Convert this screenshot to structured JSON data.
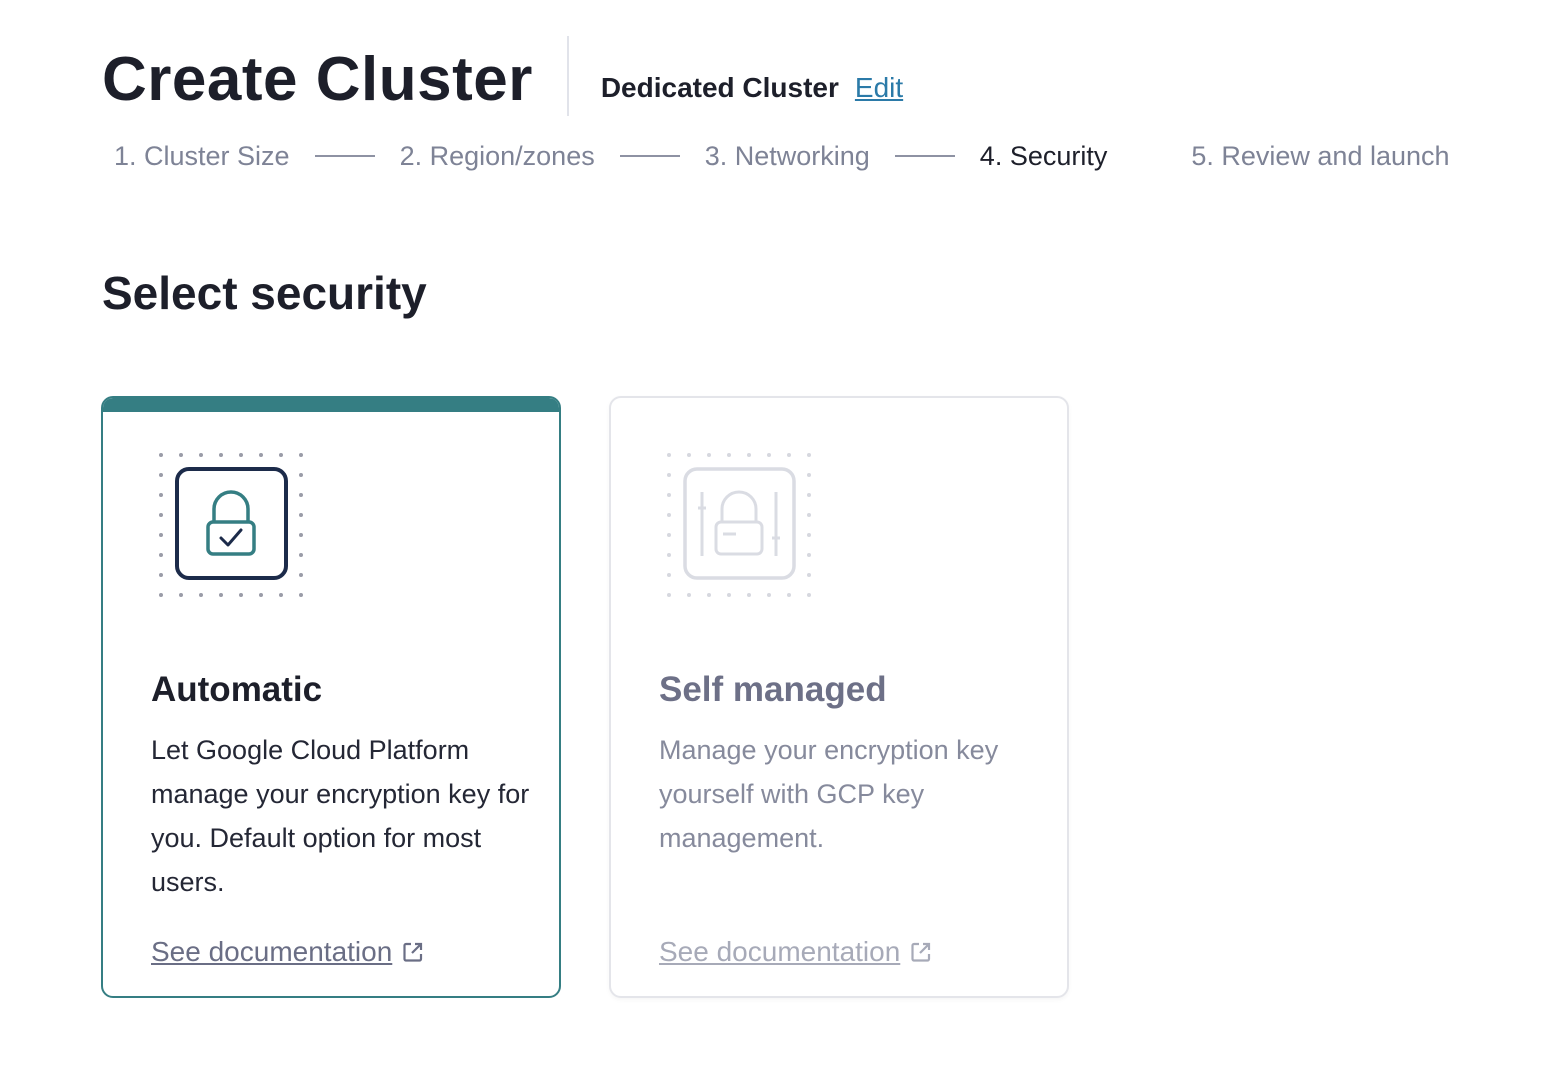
{
  "header": {
    "title": "Create Cluster",
    "cluster_type": "Dedicated Cluster",
    "edit_label": "Edit"
  },
  "stepper": {
    "steps": [
      {
        "label": "1. Cluster Size"
      },
      {
        "label": "2. Region/zones"
      },
      {
        "label": "3. Networking"
      },
      {
        "label": "4. Security",
        "active": true
      },
      {
        "label": "5. Review and launch"
      }
    ]
  },
  "section": {
    "title": "Select security"
  },
  "options": [
    {
      "title": "Automatic",
      "description": "Let Google Cloud Platform manage your encryption key for you. Default option for most users.",
      "link_label": "See documentation",
      "selected": true,
      "icon": "lock-check-icon"
    },
    {
      "title": "Self managed",
      "description": "Manage your encryption key yourself with GCP key management.",
      "link_label": "See documentation",
      "selected": false,
      "icon": "lock-sliders-icon"
    }
  ],
  "colors": {
    "accent": "#357e83",
    "link": "#2b7aa8",
    "text_dark": "#1d1f2a",
    "muted": "#7e8396"
  }
}
